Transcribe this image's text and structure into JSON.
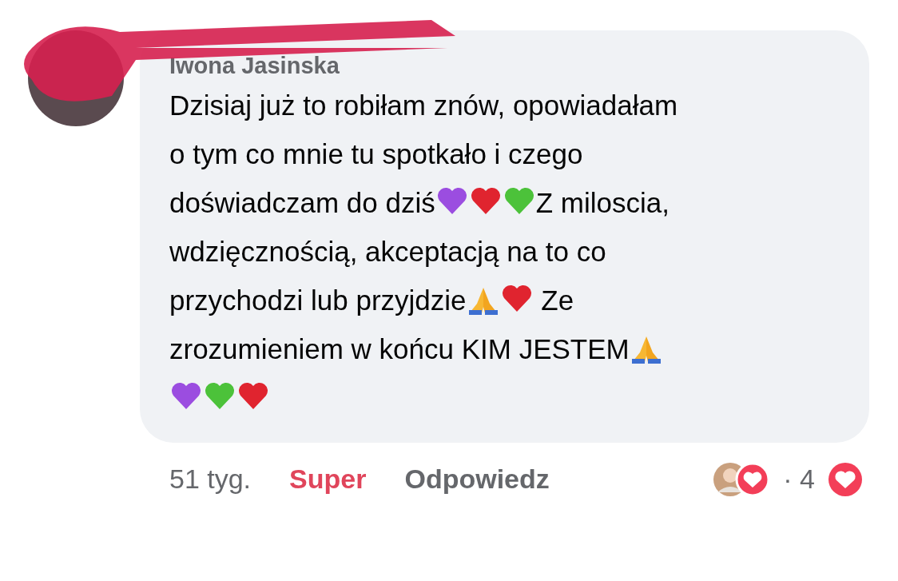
{
  "comment": {
    "author": "Iwona Jasinska",
    "segments": [
      {
        "kind": "text",
        "text": "Dzisiaj już to robiłam znów, opowiadałam"
      },
      {
        "kind": "break"
      },
      {
        "kind": "text",
        "text": "o tym co mnie tu spotkało i czego"
      },
      {
        "kind": "break"
      },
      {
        "kind": "text",
        "text": "doświadczam do dziś"
      },
      {
        "kind": "heart",
        "color": "#9b4de0"
      },
      {
        "kind": "heart",
        "color": "#e0242f"
      },
      {
        "kind": "heart",
        "color": "#4cc23a"
      },
      {
        "kind": "text",
        "text": "Z miloscia,"
      },
      {
        "kind": "break"
      },
      {
        "kind": "text",
        "text": "wdzięcznością, akceptacją na to co"
      },
      {
        "kind": "break"
      },
      {
        "kind": "text",
        "text": "przychodzi lub przyjdzie"
      },
      {
        "kind": "pray"
      },
      {
        "kind": "heart",
        "color": "#e0242f"
      },
      {
        "kind": "text",
        "text": " Ze"
      },
      {
        "kind": "break"
      },
      {
        "kind": "text",
        "text": "zrozumieniem w końcu KIM JESTEM"
      },
      {
        "kind": "pray"
      },
      {
        "kind": "break"
      },
      {
        "kind": "heart",
        "color": "#9b4de0"
      },
      {
        "kind": "heart",
        "color": "#4cc23a"
      },
      {
        "kind": "heart",
        "color": "#e0242f"
      }
    ]
  },
  "footer": {
    "time": "51 tyg.",
    "reaction_label": "Super",
    "reply": "Odpowiedz",
    "reaction_count": "· 4"
  }
}
